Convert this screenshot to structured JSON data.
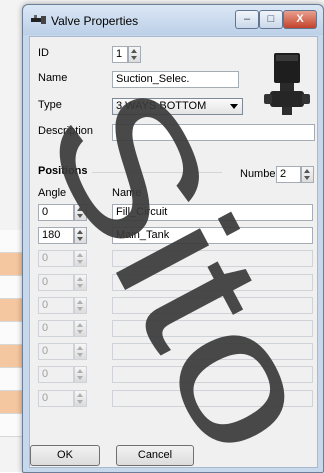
{
  "window": {
    "title": "Valve Properties",
    "min_glyph": "–",
    "max_glyph": "□",
    "close_glyph": "X"
  },
  "fields": {
    "id_label": "ID",
    "id_value": "1",
    "name_label": "Name",
    "name_value": "Suction_Selec.",
    "type_label": "Type",
    "type_value": "3 WAYS BOTTOM",
    "description_label": "Description",
    "description_value": ""
  },
  "positions": {
    "section_label": "Positions",
    "number_label": "Number",
    "number_value": "2",
    "angle_header": "Angle",
    "name_header": "Name",
    "rows": [
      {
        "angle": "0",
        "name": "Fill_Circuit",
        "enabled": true
      },
      {
        "angle": "180",
        "name": "Main_Tank",
        "enabled": true
      },
      {
        "angle": "0",
        "name": "",
        "enabled": false
      },
      {
        "angle": "0",
        "name": "",
        "enabled": false
      },
      {
        "angle": "0",
        "name": "",
        "enabled": false
      },
      {
        "angle": "0",
        "name": "",
        "enabled": false
      },
      {
        "angle": "0",
        "name": "",
        "enabled": false
      },
      {
        "angle": "0",
        "name": "",
        "enabled": false
      },
      {
        "angle": "0",
        "name": "",
        "enabled": false
      }
    ]
  },
  "buttons": {
    "ok": "OK",
    "cancel": "Cancel"
  },
  "watermark": {
    "text": "Sito"
  },
  "colors": {
    "titlebar": "#c7d8ec",
    "close": "#c3422b",
    "client": "#f0f0f0",
    "watermark": "#3a3a3a",
    "valve_body": "#1e1e1e"
  }
}
